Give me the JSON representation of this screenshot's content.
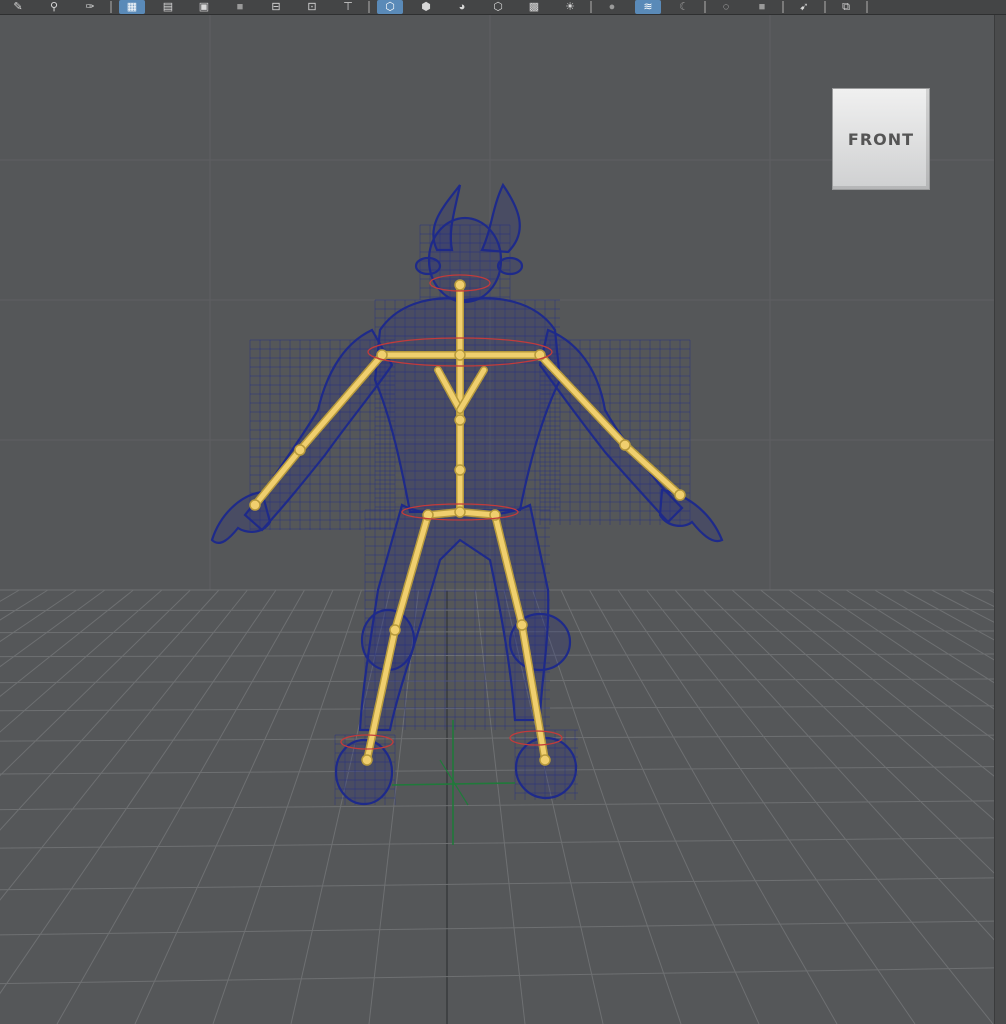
{
  "toolbar": {
    "buttons": [
      {
        "name": "pencil-icon",
        "glyph": "✎"
      },
      {
        "name": "search-icon",
        "glyph": "⚲"
      },
      {
        "name": "brush-icon",
        "glyph": "✑"
      },
      {
        "name": "separator"
      },
      {
        "name": "grid-icon",
        "glyph": "▦",
        "active": true
      },
      {
        "name": "film-gate-icon",
        "glyph": "▤"
      },
      {
        "name": "resolution-gate-icon",
        "glyph": "▣"
      },
      {
        "name": "camera-icon",
        "glyph": "■",
        "dim": true
      },
      {
        "name": "field-chart-icon",
        "glyph": "⊟"
      },
      {
        "name": "safe-action-icon",
        "glyph": "⊡"
      },
      {
        "name": "safe-title-icon",
        "glyph": "⊤"
      },
      {
        "name": "separator"
      },
      {
        "name": "wireframe-icon",
        "glyph": "⬡",
        "active": true
      },
      {
        "name": "smooth-shade-icon",
        "glyph": "⬢"
      },
      {
        "name": "default-material-icon",
        "glyph": "◕"
      },
      {
        "name": "wireframe-on-shaded-icon",
        "glyph": "⬡"
      },
      {
        "name": "textured-icon",
        "glyph": "▩"
      },
      {
        "name": "lighting-icon",
        "glyph": "☀"
      },
      {
        "name": "separator"
      },
      {
        "name": "shadows-icon",
        "glyph": "●",
        "dim": true
      },
      {
        "name": "xray-icon",
        "glyph": "≋",
        "active": true
      },
      {
        "name": "ambient-occlusion-icon",
        "glyph": "☾",
        "dim": true
      },
      {
        "name": "separator"
      },
      {
        "name": "isolate-select-icon",
        "glyph": "◌"
      },
      {
        "name": "xray-joints-icon",
        "glyph": "■",
        "dim": true
      },
      {
        "name": "separator"
      },
      {
        "name": "select-tool-icon",
        "glyph": "➹"
      },
      {
        "name": "separator"
      },
      {
        "name": "panel-layout-icon",
        "glyph": "⧉"
      },
      {
        "name": "separator"
      }
    ]
  },
  "viewport": {
    "view_cube_label": "FRONT",
    "colors": {
      "background": "#555759",
      "grid": "#6e7072",
      "grid_axis": "#3a3c3e",
      "mesh_wire": "#1e2a8a",
      "joints": "#f0cf6e",
      "joint_outline": "#b79a3c",
      "ik_handle": "#c23b3b",
      "origin_axis": "#1f7a3a"
    }
  }
}
